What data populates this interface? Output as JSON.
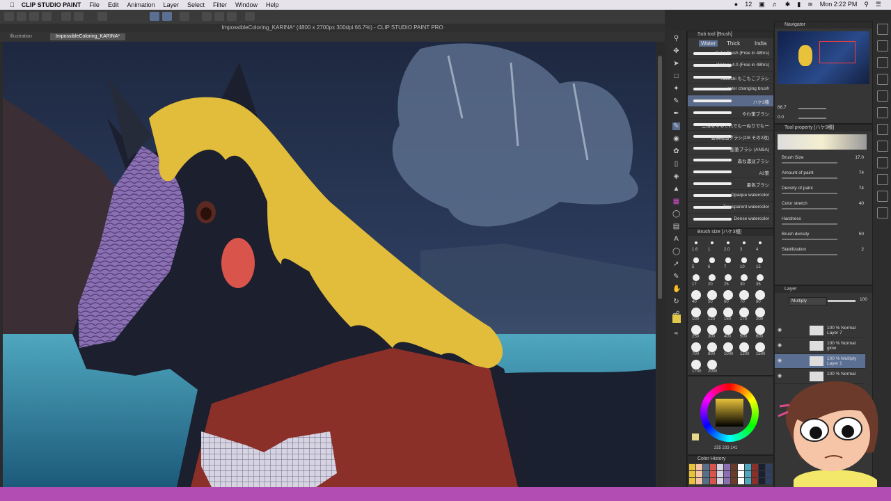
{
  "menubar": {
    "app": "CLIP STUDIO PAINT",
    "items": [
      "File",
      "Edit",
      "Animation",
      "Layer",
      "Select",
      "Filter",
      "Window",
      "Help"
    ],
    "clock": "Mon 2:22 PM",
    "num_badge": "12"
  },
  "document": {
    "title": "ImpossibleColoring_KARINA* (4800 x 2700px 300dpi 66.7%) - CLIP STUDIO PAINT PRO"
  },
  "tabs": [
    "Illustration",
    "ImpossibleColoring_KARINA*"
  ],
  "subtool": {
    "header": "Sub tool [Brush]",
    "groups": [
      "Water",
      "Thick",
      "India"
    ],
    "brushes": [
      "S-A | Brush (Free in 48hrs)",
      "Watery 4.0 (Free in 48hrs)",
      "hakushi もこもこブラシ",
      "color changing brush",
      "ハケ3種",
      "やわ筆ブラシ",
      "土佐も今もそれでも一ぬりでもー",
      "雲鱗絵画ブラシ(2/8 その2改)",
      "鉛筆ブラシ (ANSA)",
      "森な濃淡ブラシ",
      "A2筆",
      "墨色ブラシ",
      "Opaque watercolor",
      "Transparent watercolor",
      "Dense watercolor"
    ]
  },
  "navigator": {
    "header": "Navigator",
    "zoom": "66.7",
    "angle": "0.0"
  },
  "tool_property": {
    "header": "Tool property [ハケ3種]",
    "rows": [
      {
        "label": "Brush Size",
        "value": "17.0"
      },
      {
        "label": "Amount of paint",
        "value": "74"
      },
      {
        "label": "Density of paint",
        "value": "74"
      },
      {
        "label": "Color stretch",
        "value": "40"
      },
      {
        "label": "Hardness",
        "value": ""
      },
      {
        "label": "Brush density",
        "value": "50"
      },
      {
        "label": "Stabilization",
        "value": "2"
      }
    ]
  },
  "brush_size": {
    "header": "Brush size [ハケ3種]",
    "sizes": [
      "1.6",
      "1",
      "2.0",
      "3",
      "4",
      "5",
      "6",
      "7",
      "10",
      "15",
      "17",
      "20",
      "25",
      "30",
      "35",
      "40",
      "50",
      "60",
      "70",
      "80",
      "100",
      "120",
      "150",
      "170",
      "200",
      "250",
      "300",
      "400",
      "500",
      "600",
      "700",
      "800",
      "1000",
      "1200",
      "1500",
      "1700",
      "2000"
    ]
  },
  "layer": {
    "header": "Layer",
    "blend": "Multiply",
    "opacity": "100",
    "rows": [
      {
        "pct": "100 % Normal",
        "name": "Layer 7"
      },
      {
        "pct": "100 % Normal",
        "name": "glow"
      },
      {
        "pct": "100 % Multiply",
        "name": "Layer 1"
      },
      {
        "pct": "100 % Normal",
        "name": ""
      }
    ]
  },
  "color_wheel": {
    "values": "255 233 141"
  },
  "color_history": {
    "header": "Color History"
  },
  "colors": {
    "yellow": "#e8c23a",
    "purple": "#8a6fb3",
    "accent": "#b24db3",
    "select": "#5b6f93"
  }
}
